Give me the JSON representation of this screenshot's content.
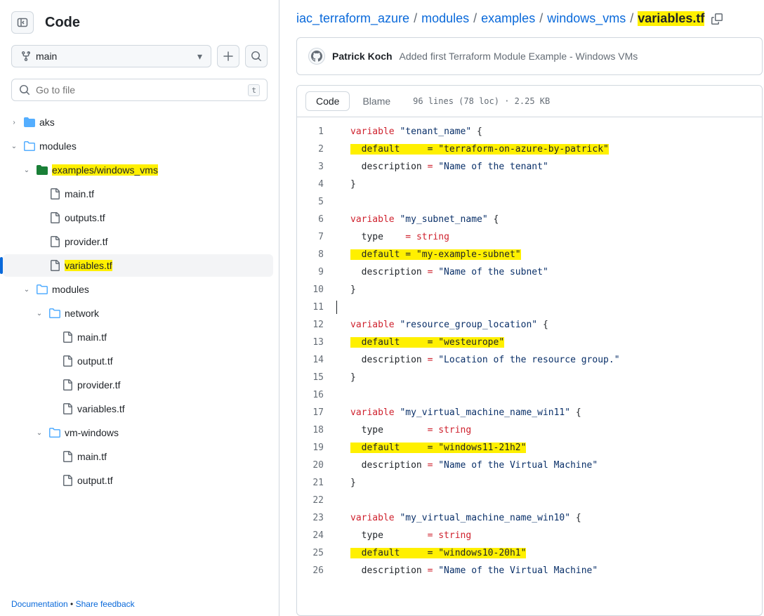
{
  "sidebar": {
    "title": "Code",
    "branch_label": "main",
    "gotofile_placeholder": "Go to file",
    "kbd_hint": "t",
    "tree": [
      {
        "type": "folder",
        "label": "aks",
        "depth": 0,
        "expanded": false
      },
      {
        "type": "folder",
        "label": "modules",
        "depth": 0,
        "expanded": true
      },
      {
        "type": "folder",
        "label": "examples/windows_vms",
        "depth": 1,
        "expanded": true,
        "highlight": true,
        "green": true
      },
      {
        "type": "file",
        "label": "main.tf",
        "depth": 2
      },
      {
        "type": "file",
        "label": "outputs.tf",
        "depth": 2
      },
      {
        "type": "file",
        "label": "provider.tf",
        "depth": 2
      },
      {
        "type": "file",
        "label": "variables.tf",
        "depth": 2,
        "highlight": true,
        "selected": true
      },
      {
        "type": "folder",
        "label": "modules",
        "depth": 1,
        "expanded": true
      },
      {
        "type": "folder",
        "label": "network",
        "depth": 2,
        "expanded": true
      },
      {
        "type": "file",
        "label": "main.tf",
        "depth": 3
      },
      {
        "type": "file",
        "label": "output.tf",
        "depth": 3
      },
      {
        "type": "file",
        "label": "provider.tf",
        "depth": 3
      },
      {
        "type": "file",
        "label": "variables.tf",
        "depth": 3
      },
      {
        "type": "folder",
        "label": "vm-windows",
        "depth": 2,
        "expanded": true
      },
      {
        "type": "file",
        "label": "main.tf",
        "depth": 3
      },
      {
        "type": "file",
        "label": "output.tf",
        "depth": 3
      }
    ],
    "footer_doc": "Documentation",
    "footer_sep": " • ",
    "footer_feedback": "Share feedback"
  },
  "breadcrumb": {
    "parts": [
      "iac_terraform_azure",
      "modules",
      "examples",
      "windows_vms"
    ],
    "current": "variables.tf"
  },
  "commit": {
    "author": "Patrick Koch",
    "message": "Added first Terraform Module Example - Windows VMs"
  },
  "code": {
    "tab_code": "Code",
    "tab_blame": "Blame",
    "meta": "96 lines (78 loc) · 2.25 KB",
    "lines": [
      [
        {
          "t": "variable ",
          "c": "kw"
        },
        {
          "t": "\"tenant_name\"",
          "c": "str"
        },
        {
          "t": " {",
          "c": "op"
        }
      ],
      [
        {
          "t": "  default     = \"terraform-on-azure-by-patrick\"",
          "hl": true
        }
      ],
      [
        {
          "t": "  description "
        },
        {
          "t": "= ",
          "c": "eq-red"
        },
        {
          "t": "\"Name of the tenant\"",
          "c": "str"
        }
      ],
      [
        {
          "t": "}",
          "c": "op"
        }
      ],
      [
        {
          "t": ""
        }
      ],
      [
        {
          "t": "variable ",
          "c": "kw"
        },
        {
          "t": "\"my_subnet_name\"",
          "c": "str"
        },
        {
          "t": " {",
          "c": "op"
        }
      ],
      [
        {
          "t": "  type    "
        },
        {
          "t": "= ",
          "c": "eq-red"
        },
        {
          "t": "string",
          "c": "kw"
        }
      ],
      [
        {
          "t": "  default = \"my-example-subnet\"",
          "hl": true
        }
      ],
      [
        {
          "t": "  description "
        },
        {
          "t": "= ",
          "c": "eq-red"
        },
        {
          "t": "\"Name of the subnet\"",
          "c": "str"
        }
      ],
      [
        {
          "t": "}",
          "c": "op"
        }
      ],
      [
        {
          "t": "",
          "caret": true
        }
      ],
      [
        {
          "t": "variable ",
          "c": "kw"
        },
        {
          "t": "\"resource_group_location\"",
          "c": "str"
        },
        {
          "t": " {",
          "c": "op"
        }
      ],
      [
        {
          "t": "  default     = \"westeurope\"",
          "hl": true
        }
      ],
      [
        {
          "t": "  description "
        },
        {
          "t": "= ",
          "c": "eq-red"
        },
        {
          "t": "\"Location of the resource group.\"",
          "c": "str"
        }
      ],
      [
        {
          "t": "}",
          "c": "op"
        }
      ],
      [
        {
          "t": ""
        }
      ],
      [
        {
          "t": "variable ",
          "c": "kw"
        },
        {
          "t": "\"my_virtual_machine_name_win11\"",
          "c": "str"
        },
        {
          "t": " {",
          "c": "op"
        }
      ],
      [
        {
          "t": "  type        "
        },
        {
          "t": "= ",
          "c": "eq-red"
        },
        {
          "t": "string",
          "c": "kw"
        }
      ],
      [
        {
          "t": "  default     = \"windows11-21h2\"",
          "hl": true
        }
      ],
      [
        {
          "t": "  description "
        },
        {
          "t": "= ",
          "c": "eq-red"
        },
        {
          "t": "\"Name of the Virtual Machine\"",
          "c": "str"
        }
      ],
      [
        {
          "t": "}",
          "c": "op"
        }
      ],
      [
        {
          "t": ""
        }
      ],
      [
        {
          "t": "variable ",
          "c": "kw"
        },
        {
          "t": "\"my_virtual_machine_name_win10\"",
          "c": "str"
        },
        {
          "t": " {",
          "c": "op"
        }
      ],
      [
        {
          "t": "  type        "
        },
        {
          "t": "= ",
          "c": "eq-red"
        },
        {
          "t": "string",
          "c": "kw"
        }
      ],
      [
        {
          "t": "  default     = \"windows10-20h1\"",
          "hl": true
        }
      ],
      [
        {
          "t": "  description "
        },
        {
          "t": "= ",
          "c": "eq-red"
        },
        {
          "t": "\"Name of the Virtual Machine\"",
          "c": "str"
        }
      ]
    ]
  }
}
